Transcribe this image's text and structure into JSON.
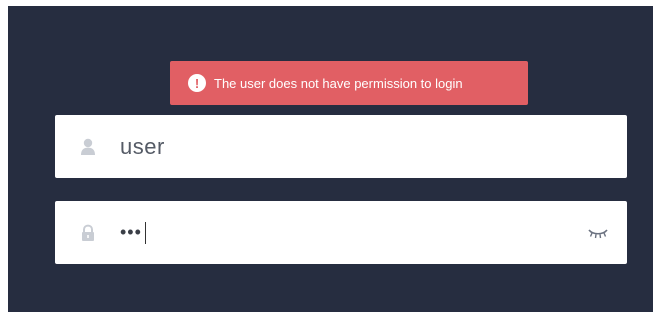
{
  "alert": {
    "message": "The user does not have permission to login",
    "icon": "exclamation-circle-icon",
    "bg_color": "#e15f64"
  },
  "form": {
    "username": {
      "value": "user",
      "icon": "user-icon"
    },
    "password": {
      "value_masked": "•••",
      "icon": "lock-icon",
      "toggle_icon": "eye-closed-icon"
    }
  },
  "theme": {
    "background": "#262d40",
    "field_bg": "#ffffff"
  }
}
